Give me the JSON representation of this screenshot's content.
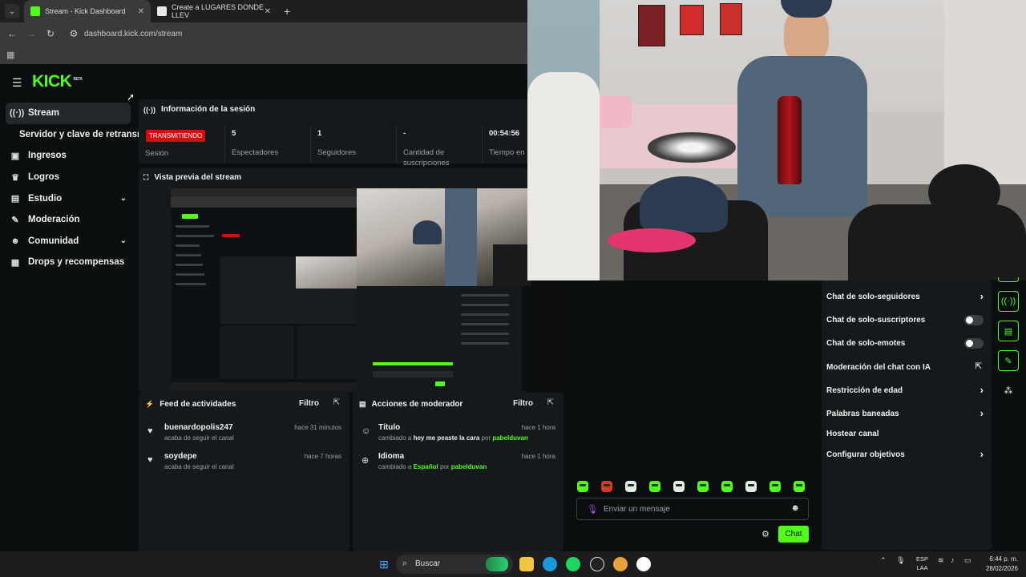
{
  "browser": {
    "tabs": [
      {
        "title": "Stream - Kick Dashboard",
        "favicon_color": "#53fc18"
      },
      {
        "title": "Create a LUGARES DONDE LLEV",
        "favicon_color": "#e8e8e8"
      }
    ],
    "new_tab": "+",
    "url": "dashboard.kick.com/stream"
  },
  "kick": {
    "logo": "KICK",
    "logo_tag": "BETA",
    "sidebar": [
      {
        "label": "Stream",
        "icon": "broadcast-icon"
      },
      {
        "label": "Servidor y clave de retransm",
        "icon": ""
      },
      {
        "label": "Ingresos",
        "icon": "money-icon"
      },
      {
        "label": "Logros",
        "icon": "trophy-icon"
      },
      {
        "label": "Estudio",
        "icon": "studio-icon"
      },
      {
        "label": "Moderación",
        "icon": "wrench-icon"
      },
      {
        "label": "Comunidad",
        "icon": "community-icon"
      },
      {
        "label": "Drops y recompensas",
        "icon": "gift-icon"
      }
    ],
    "session": {
      "title": "Información de la sesión",
      "live_badge": "TRANSMITIENDO",
      "session_label": "Sesión",
      "stats": [
        {
          "value": "5",
          "label": "Espectadores",
          "label2": ""
        },
        {
          "value": "1",
          "label": "Seguidores",
          "label2": ""
        },
        {
          "value": "-",
          "label": "Cantidad de",
          "label2": "suscripciones"
        },
        {
          "value": "00:54:56",
          "label": "Tiempo en",
          "label2": ""
        }
      ]
    },
    "preview": {
      "title": "Vista previa del stream"
    },
    "feed": {
      "title": "Feed de actividades",
      "filter": "Filtro",
      "items": [
        {
          "name": "buenardopolis247",
          "desc": "acaba de seguir el canal",
          "time": "hace 31 minutos"
        },
        {
          "name": "soydepe",
          "desc": "acaba de seguir el canal",
          "time": "hace 7 horas"
        }
      ]
    },
    "mod": {
      "title": "Acciones de moderador",
      "filter": "Filtro",
      "items": [
        {
          "name": "Título",
          "pre": "cambiado a",
          "value": "hey me peaste la cara",
          "by": "por",
          "user": "pabelduvan",
          "time": "hace 1 hora"
        },
        {
          "name": "Idioma",
          "pre": "cambiado a",
          "value": "Español",
          "by": "por",
          "user": "pabelduvan",
          "time": "hace 1 hora"
        }
      ]
    }
  },
  "chat": {
    "placeholder": "Enviar un mensaje",
    "send_label": "Chat"
  },
  "settings_menu": [
    {
      "label": "Chat de solo-seguidores",
      "control": "arrow"
    },
    {
      "label": "Chat de solo-suscriptores",
      "control": "toggle"
    },
    {
      "label": "Chat de solo-emotes",
      "control": "toggle"
    },
    {
      "label": "Moderación del chat con IA",
      "control": "external"
    },
    {
      "label": "Restricción de edad",
      "control": "arrow"
    },
    {
      "label": "Palabras baneadas",
      "control": "arrow"
    },
    {
      "label": "Hostear canal",
      "control": "none"
    },
    {
      "label": "Configurar objetivos",
      "control": "arrow"
    }
  ],
  "taskbar": {
    "search": "Buscar",
    "lang_line1": "ESP",
    "lang_line2": "LAA",
    "time": "6:44 p. m.",
    "date": "28/02/2026"
  },
  "colors": {
    "kick_green": "#53fc18",
    "live_red": "#d10f0f",
    "bg": "#0b0e0f",
    "card": "#16191b"
  }
}
